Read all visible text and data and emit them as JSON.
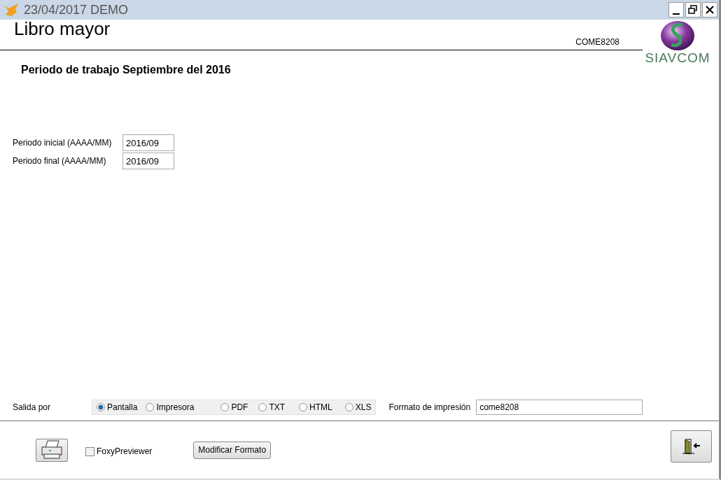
{
  "window": {
    "title": "23/04/2017  DEMO"
  },
  "header": {
    "title": "Libro mayor",
    "code": "COME8208",
    "logo_text": "SIAVCOM"
  },
  "period_heading": "Periodo de trabajo Septiembre del 2016",
  "fields": [
    {
      "label": "Periodo  inicial (AAAA/MM)",
      "value": "2016/09"
    },
    {
      "label": "Periodo final (AAAA/MM)",
      "value": "2016/09"
    }
  ],
  "output": {
    "label": "Salida por",
    "options": [
      {
        "label": "Pantalla",
        "selected": true
      },
      {
        "label": "Impresora",
        "selected": false
      },
      {
        "label": "PDF",
        "selected": false
      },
      {
        "label": "TXT",
        "selected": false
      },
      {
        "label": "HTML",
        "selected": false
      },
      {
        "label": "XLS",
        "selected": false
      }
    ]
  },
  "print_format": {
    "label": "Formato de impresión",
    "value": "come8208"
  },
  "foxy_previewer": {
    "label": "FoxyPreviewer",
    "checked": false
  },
  "modify_button": "Modificar Formato"
}
